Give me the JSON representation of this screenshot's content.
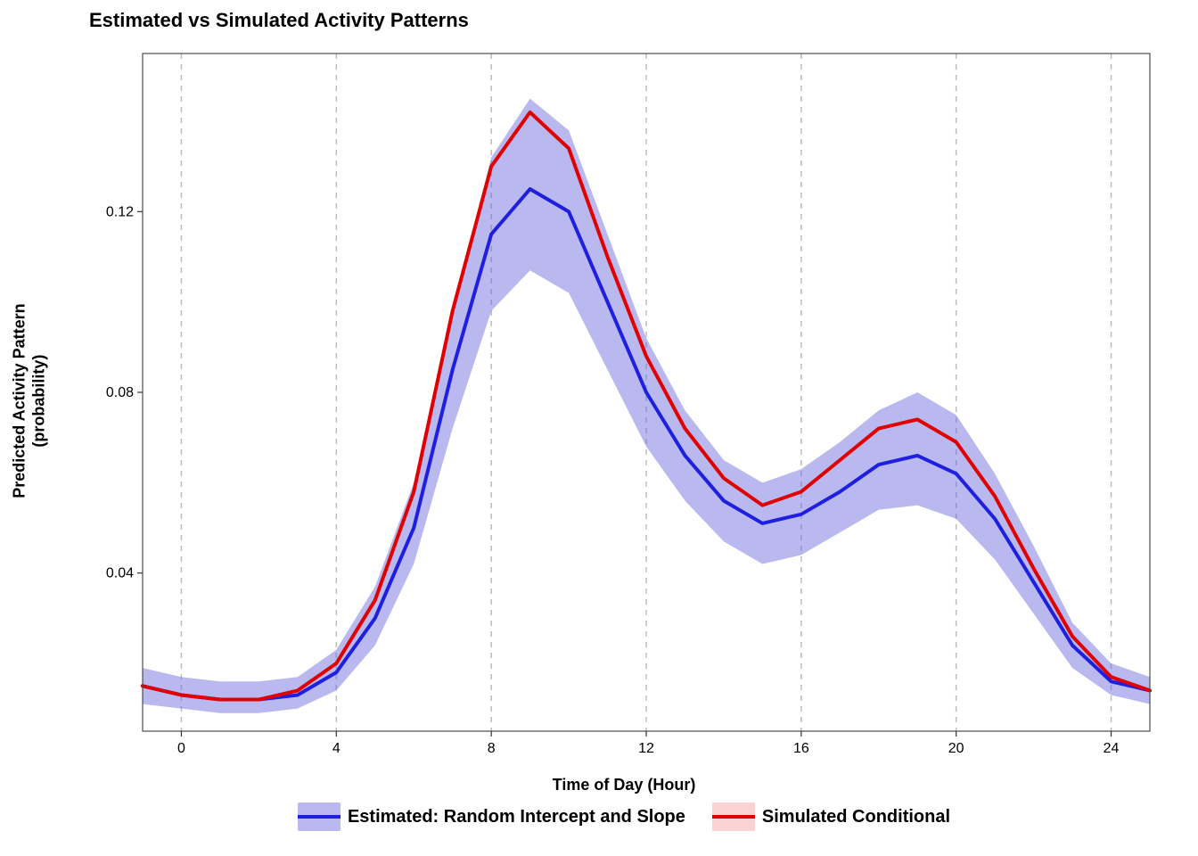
{
  "chart_data": {
    "type": "line",
    "title": "Estimated vs Simulated Activity Patterns",
    "xlabel": "Time of Day (Hour)",
    "ylabel": "Predicted Activity Pattern\n(probability)",
    "xlim": [
      -1,
      25
    ],
    "ylim": [
      0.005,
      0.155
    ],
    "x_ticks": [
      0,
      4,
      8,
      12,
      16,
      20,
      24
    ],
    "y_ticks": [
      0.04,
      0.08,
      0.12
    ],
    "grid_x": [
      0,
      4,
      8,
      12,
      16,
      20,
      24
    ],
    "x": [
      -1,
      0,
      1,
      2,
      3,
      4,
      5,
      6,
      7,
      8,
      9,
      10,
      11,
      12,
      13,
      14,
      15,
      16,
      17,
      18,
      19,
      20,
      21,
      22,
      23,
      24,
      25
    ],
    "series": [
      {
        "name": "Estimated: Random Intercept and Slope",
        "color": "#1f1fe0",
        "ribbon_color": "rgba(100,100,220,0.45)",
        "values": [
          0.015,
          0.013,
          0.012,
          0.012,
          0.013,
          0.018,
          0.03,
          0.05,
          0.085,
          0.115,
          0.125,
          0.12,
          0.1,
          0.08,
          0.066,
          0.056,
          0.051,
          0.053,
          0.058,
          0.064,
          0.066,
          0.062,
          0.052,
          0.038,
          0.024,
          0.016,
          0.014
        ],
        "ribbon_lo": [
          0.011,
          0.01,
          0.009,
          0.009,
          0.01,
          0.014,
          0.024,
          0.042,
          0.072,
          0.098,
          0.107,
          0.102,
          0.085,
          0.068,
          0.056,
          0.047,
          0.042,
          0.044,
          0.049,
          0.054,
          0.055,
          0.052,
          0.043,
          0.031,
          0.019,
          0.013,
          0.011
        ],
        "ribbon_hi": [
          0.019,
          0.017,
          0.016,
          0.016,
          0.017,
          0.023,
          0.037,
          0.06,
          0.098,
          0.132,
          0.145,
          0.138,
          0.115,
          0.092,
          0.076,
          0.065,
          0.06,
          0.063,
          0.069,
          0.076,
          0.08,
          0.075,
          0.062,
          0.046,
          0.029,
          0.02,
          0.017
        ]
      },
      {
        "name": "Simulated Conditional",
        "color": "#e00000",
        "ribbon_color": "rgba(230,80,80,0.25)",
        "values": [
          0.015,
          0.013,
          0.012,
          0.012,
          0.014,
          0.02,
          0.034,
          0.058,
          0.098,
          0.13,
          0.142,
          0.134,
          0.11,
          0.088,
          0.072,
          0.061,
          0.055,
          0.058,
          0.065,
          0.072,
          0.074,
          0.069,
          0.057,
          0.041,
          0.026,
          0.017,
          0.014
        ]
      }
    ],
    "legend": {
      "position": "bottom",
      "items": [
        {
          "label": "Estimated: Random Intercept and Slope",
          "fill": "rgba(100,100,220,0.45)",
          "line": "#1f1fe0"
        },
        {
          "label": "Simulated Conditional",
          "fill": "rgba(230,80,80,0.25)",
          "line": "#e00000"
        }
      ]
    }
  }
}
